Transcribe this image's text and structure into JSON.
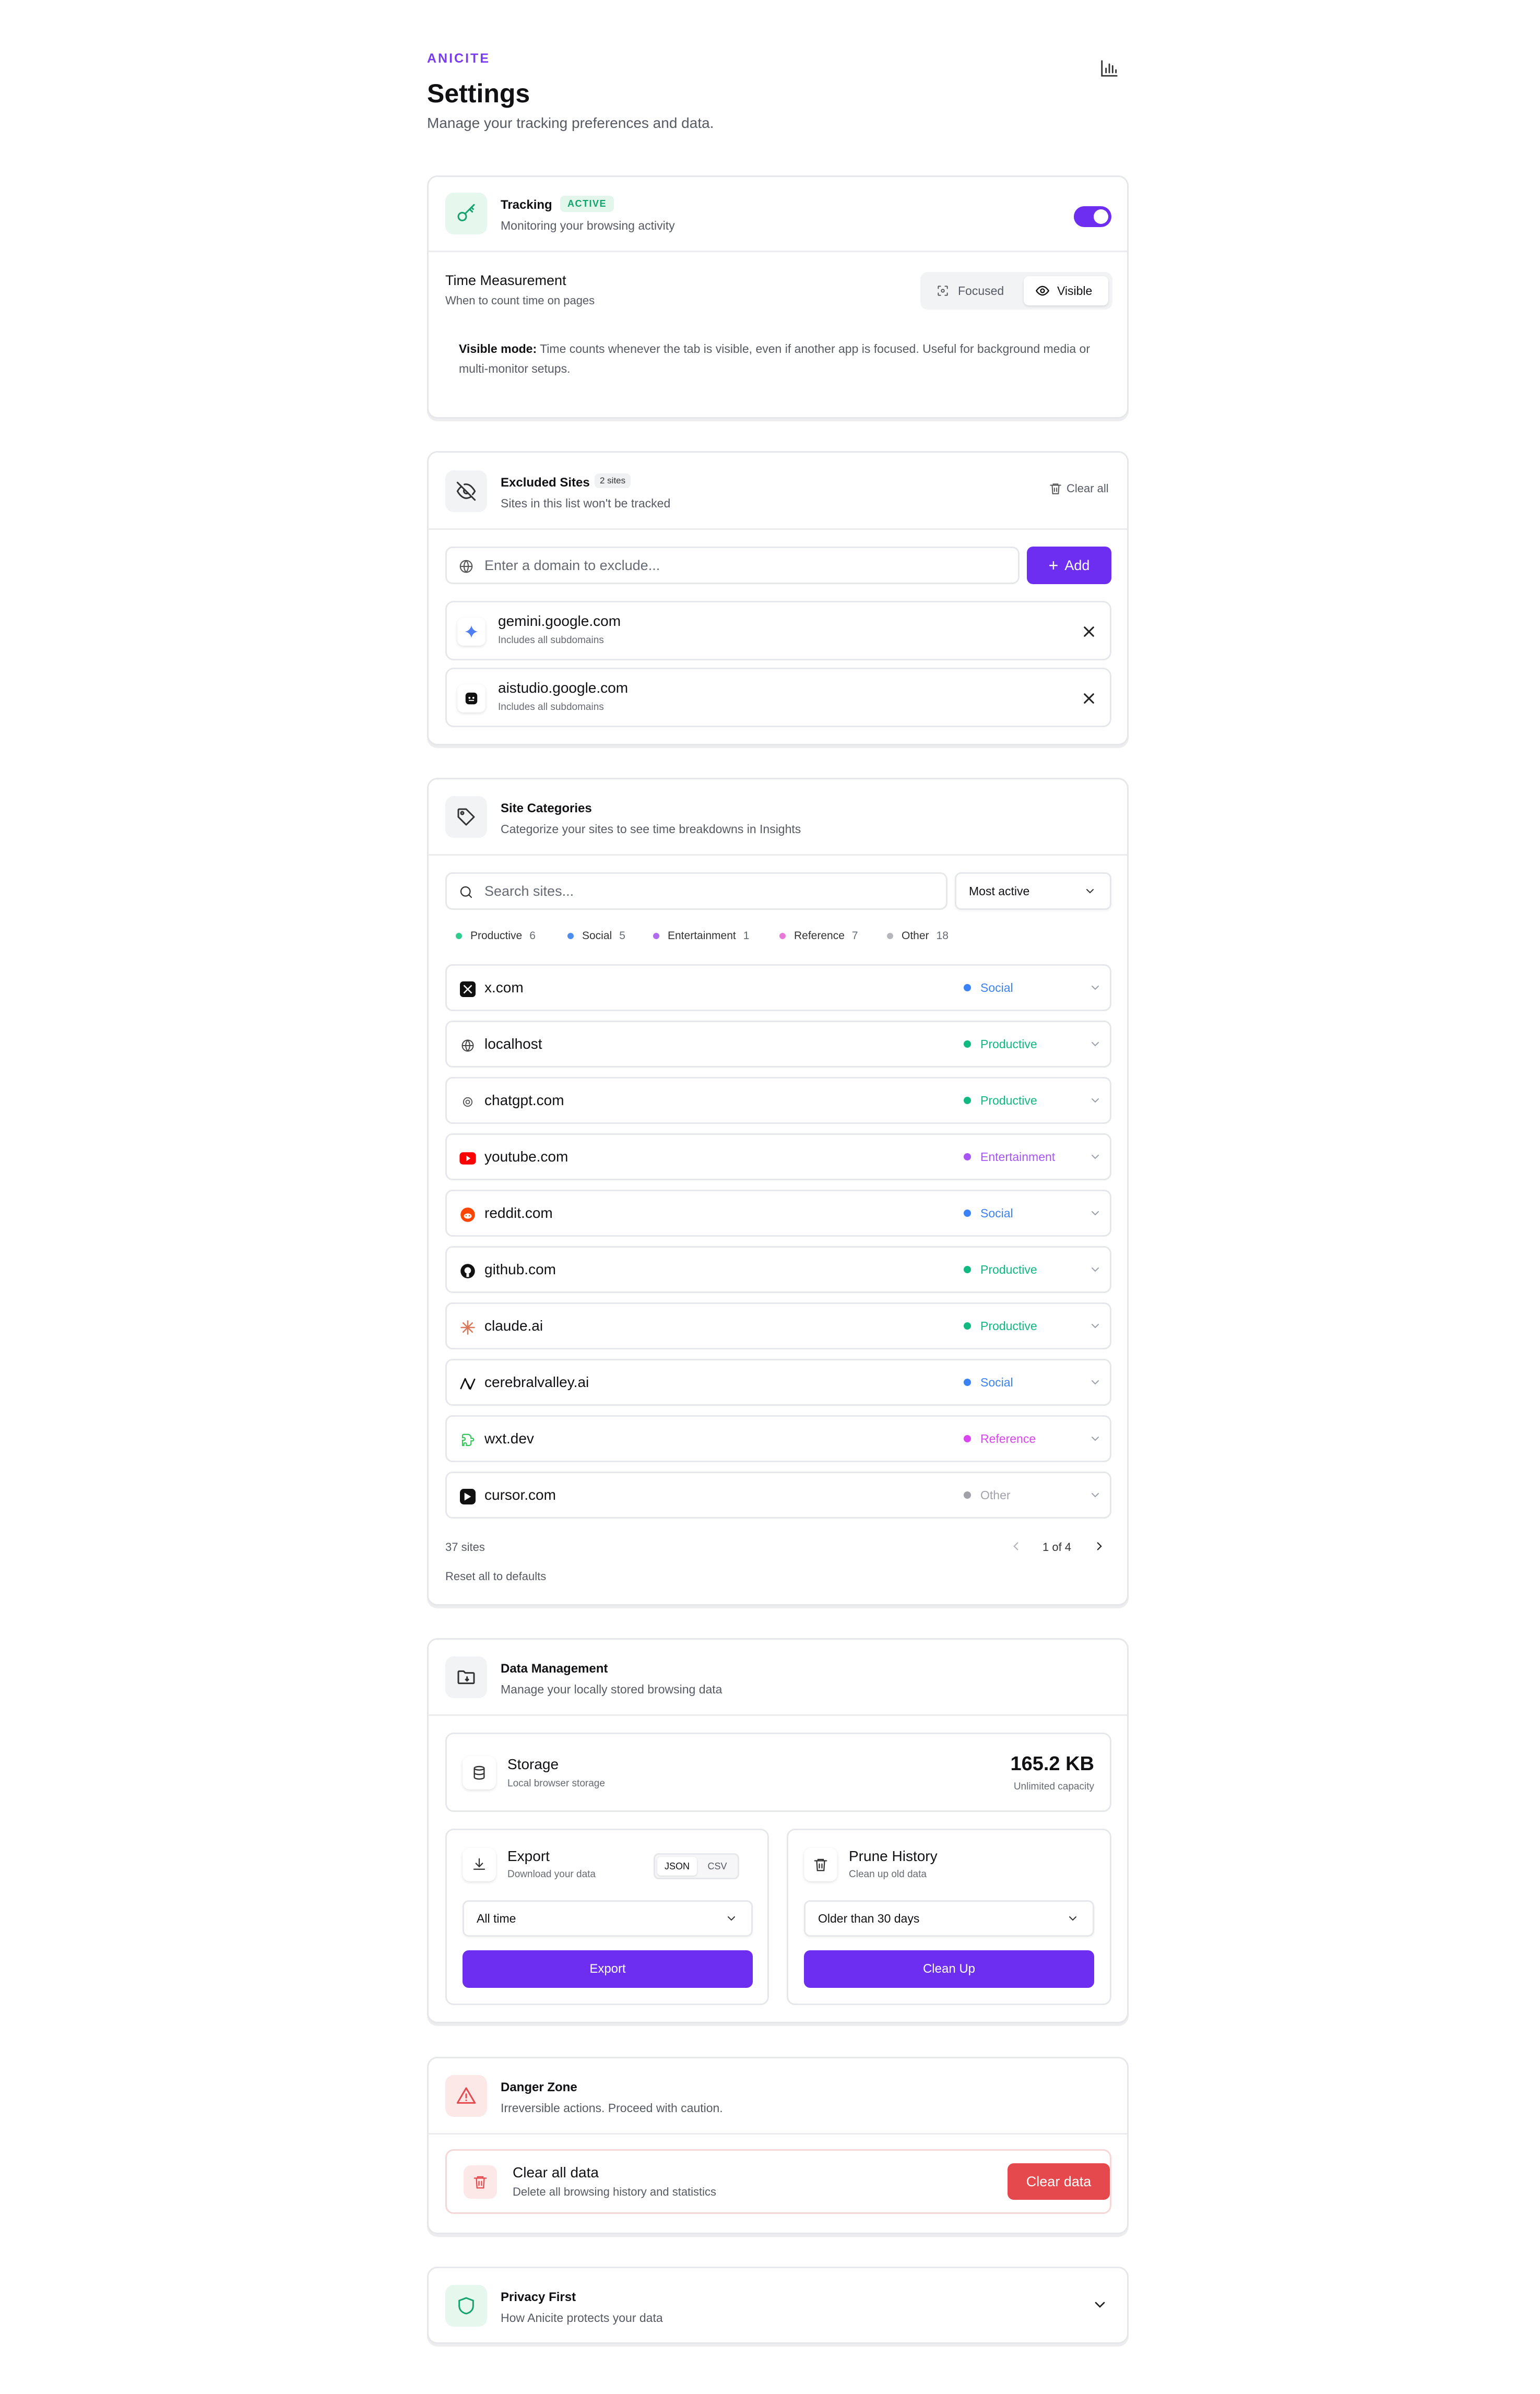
{
  "header": {
    "brand": "ANICITE",
    "title": "Settings",
    "subtitle": "Manage your tracking preferences and data.",
    "insights_icon": "bar-chart-icon"
  },
  "tracking": {
    "title": "Tracking",
    "badge": "ACTIVE",
    "subtitle": "Monitoring your browsing activity",
    "enabled": true,
    "time_measurement": {
      "title": "Time Measurement",
      "subtitle": "When to count time on pages",
      "options": [
        "Focused",
        "Visible"
      ],
      "selected": "Visible",
      "note_label": "Visible mode:",
      "note_text": "Time counts whenever the tab is visible, even if another app is focused. Useful for background media or multi-monitor setups."
    }
  },
  "excluded": {
    "title": "Excluded Sites",
    "count_badge": "2 sites",
    "subtitle": "Sites in this list won't be tracked",
    "clear_all": "Clear all",
    "input_placeholder": "Enter a domain to exclude...",
    "add_label": "Add",
    "sites": [
      {
        "domain": "gemini.google.com",
        "note": "Includes all subdomains"
      },
      {
        "domain": "aistudio.google.com",
        "note": "Includes all subdomains"
      }
    ]
  },
  "categories": {
    "title": "Site Categories",
    "subtitle": "Categorize your sites to see time breakdowns in Insights",
    "search_placeholder": "Search sites...",
    "sort_selected": "Most active",
    "legend": [
      {
        "name": "Productive",
        "count": "6",
        "color": "#2ecc8f"
      },
      {
        "name": "Social",
        "count": "5",
        "color": "#4d8ef0"
      },
      {
        "name": "Entertainment",
        "count": "1",
        "color": "#b06cf0"
      },
      {
        "name": "Reference",
        "count": "7",
        "color": "#e879d8"
      },
      {
        "name": "Other",
        "count": "18",
        "color": "#b5b7bc"
      }
    ],
    "sites": [
      {
        "domain": "x.com",
        "category": "Social",
        "color": "#3b82f6"
      },
      {
        "domain": "localhost",
        "category": "Productive",
        "color": "#10b981"
      },
      {
        "domain": "chatgpt.com",
        "category": "Productive",
        "color": "#10b981"
      },
      {
        "domain": "youtube.com",
        "category": "Entertainment",
        "color": "#a855f7"
      },
      {
        "domain": "reddit.com",
        "category": "Social",
        "color": "#3b82f6"
      },
      {
        "domain": "github.com",
        "category": "Productive",
        "color": "#10b981"
      },
      {
        "domain": "claude.ai",
        "category": "Productive",
        "color": "#10b981"
      },
      {
        "domain": "cerebralvalley.ai",
        "category": "Social",
        "color": "#3b82f6"
      },
      {
        "domain": "wxt.dev",
        "category": "Reference",
        "color": "#d946ef"
      },
      {
        "domain": "cursor.com",
        "category": "Other",
        "color": "#a1a1aa"
      }
    ],
    "total": "37 sites",
    "page_indicator": "1 of 4",
    "reset_label": "Reset all to defaults"
  },
  "data_mgmt": {
    "title": "Data Management",
    "subtitle": "Manage your locally stored browsing data",
    "storage": {
      "title": "Storage",
      "subtitle": "Local browser storage",
      "value": "165.2 KB",
      "capacity": "Unlimited capacity"
    },
    "export": {
      "title": "Export",
      "subtitle": "Download your data",
      "formats": [
        "JSON",
        "CSV"
      ],
      "selected_format": "JSON",
      "range_selected": "All time",
      "button": "Export"
    },
    "prune": {
      "title": "Prune History",
      "subtitle": "Clean up old data",
      "range_selected": "Older than 30 days",
      "button": "Clean Up"
    }
  },
  "danger": {
    "title": "Danger Zone",
    "subtitle": "Irreversible actions. Proceed with caution.",
    "action_title": "Clear all data",
    "action_subtitle": "Delete all browsing history and statistics",
    "button": "Clear data"
  },
  "privacy": {
    "title": "Privacy First",
    "subtitle": "How Anicite protects your data"
  }
}
